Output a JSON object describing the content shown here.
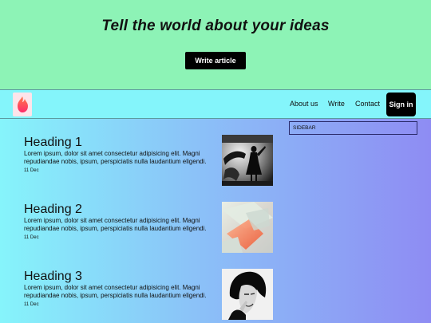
{
  "hero": {
    "title": "Tell the world about your ideas",
    "write_button": "Write article"
  },
  "nav": {
    "logo_icon": "tinder-flame-icon",
    "links": [
      "About us",
      "Write",
      "Contact"
    ],
    "signin": "Sign in"
  },
  "sidebar": {
    "label": "SIDEBAR"
  },
  "posts": [
    {
      "heading": "Heading 1",
      "body": "Lorem ipsum, dolor sit amet consectetur adipisicing elit. Magni repudiandae nobis, ipsum, perspiciatis nulla laudantium eligendi.",
      "date": "11 Dec"
    },
    {
      "heading": "Heading 2",
      "body": "Lorem ipsum, dolor sit amet consectetur adipisicing elit. Magni repudiandae nobis, ipsum, perspiciatis nulla laudantium eligendi.",
      "date": "11 Dec"
    },
    {
      "heading": "Heading 3",
      "body": "Lorem ipsum, dolor sit amet consectetur adipisicing elit. Magni repudiandae nobis, ipsum, perspiciatis nulla laudantium eligendi.",
      "date": "11 Dec"
    }
  ],
  "colors": {
    "hero_bg": "#8df3b6",
    "nav_bg": "#84f5fb",
    "gradient_start": "#86f4fb",
    "gradient_end": "#8e8cf3",
    "button_bg": "#000000"
  }
}
